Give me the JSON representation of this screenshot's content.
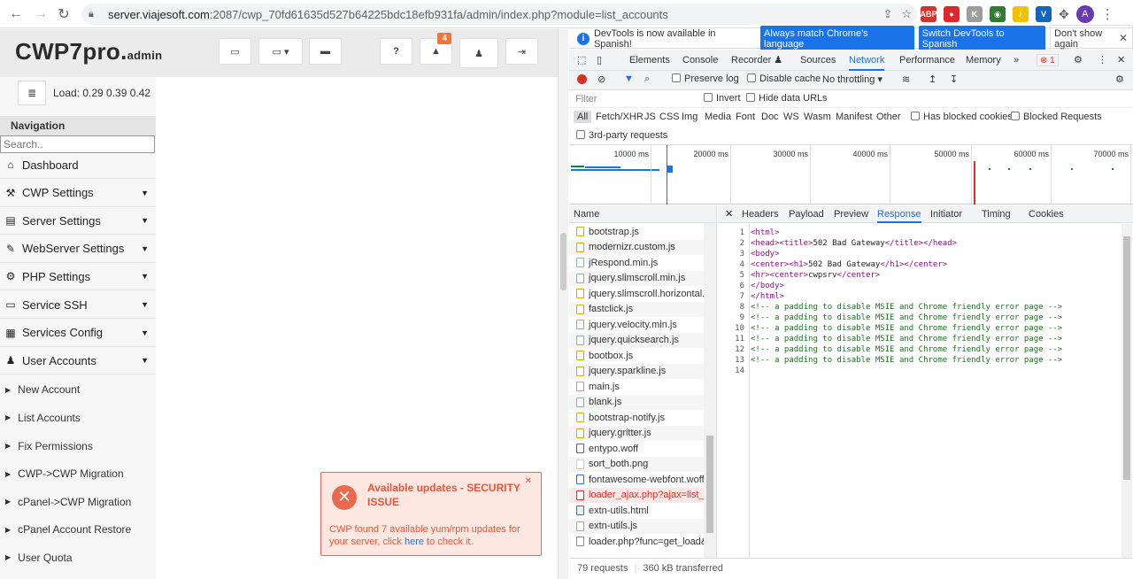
{
  "browser": {
    "url_host": "server.viajesoft.com",
    "url_rest": ":2087/cwp_70fd61635d527b64225bdc18efb931fa/admin/index.php?module=list_accounts",
    "avatar_letter": "A",
    "extensions": [
      {
        "name": "abp-icon",
        "label": "ABP",
        "color": "#d9302c"
      },
      {
        "name": "red-shield-icon",
        "label": "●",
        "color": "#e0262c"
      },
      {
        "name": "k-icon",
        "label": "K",
        "color": "#9e9e9e"
      },
      {
        "name": "globe-icon",
        "label": "◉",
        "color": "#2e7d32"
      },
      {
        "name": "note-icon",
        "label": "/",
        "color": "#f2c200"
      },
      {
        "name": "v-icon",
        "label": "V",
        "color": "#1565c0"
      }
    ]
  },
  "app": {
    "logo": "CWP7pro.",
    "logo_suffix": "admin",
    "notifications_count": "4",
    "load_label": "Load: 0.29  0.39  0.42",
    "nav_title": "Navigation",
    "search_placeholder": "Search..",
    "menu": [
      {
        "label": "Dashboard",
        "icon": "⌂",
        "caret": false
      },
      {
        "label": "CWP Settings",
        "icon": "⚒",
        "caret": true
      },
      {
        "label": "Server Settings",
        "icon": "▤",
        "caret": true
      },
      {
        "label": "WebServer Settings",
        "icon": "✎",
        "caret": true
      },
      {
        "label": "PHP Settings",
        "icon": "⚙",
        "caret": true
      },
      {
        "label": "Service SSH",
        "icon": "▭",
        "caret": true
      },
      {
        "label": "Services Config",
        "icon": "▦",
        "caret": true
      },
      {
        "label": "User Accounts",
        "icon": "♟",
        "caret": true
      }
    ],
    "submenu": [
      "New Account",
      "List Accounts",
      "Fix Permissions",
      "CWP->CWP Migration",
      "cPanel->CWP Migration",
      "cPanel Account Restore",
      "User Quota"
    ]
  },
  "notification": {
    "title": "Available updates - SECURITY ISSUE",
    "body_prefix": "CWP found 7 available yum/rpm updates for your server, click ",
    "link": "here",
    "body_suffix": " to check it."
  },
  "devtools": {
    "info_msg": "DevTools is now available in Spanish!",
    "btn_match": "Always match Chrome's language",
    "btn_switch": "Switch DevTools to Spanish",
    "btn_dont": "Don't show again",
    "tabs": [
      "Elements",
      "Console",
      "Recorder ♟",
      "Sources",
      "Network",
      "Performance",
      "Memory"
    ],
    "error_count": "1",
    "preserve_log": "Preserve log",
    "disable_cache": "Disable cache",
    "throttling": "No throttling",
    "filter_placeholder": "Filter",
    "invert": "Invert",
    "hide_data_urls": "Hide data URLs",
    "types": [
      "All",
      "Fetch/XHR",
      "JS",
      "CSS",
      "Img",
      "Media",
      "Font",
      "Doc",
      "WS",
      "Wasm",
      "Manifest",
      "Other"
    ],
    "has_blocked_cookies": "Has blocked cookies",
    "blocked_requests": "Blocked Requests",
    "third_party": "3rd-party requests",
    "timeline_ticks": [
      "10000 ms",
      "20000 ms",
      "30000 ms",
      "40000 ms",
      "50000 ms",
      "60000 ms",
      "70000 ms"
    ],
    "name_header": "Name",
    "requests": [
      {
        "name": "bootstrap.js",
        "type": "js"
      },
      {
        "name": "modernizr.custom.js",
        "type": "js"
      },
      {
        "name": "jRespond.min.js",
        "type": "js"
      },
      {
        "name": "jquery.slimscroll.min.js",
        "type": "js"
      },
      {
        "name": "jquery.slimscroll.horizontal.mi",
        "type": "js"
      },
      {
        "name": "fastclick.js",
        "type": "js"
      },
      {
        "name": "jquery.velocity.min.js",
        "type": "js"
      },
      {
        "name": "jquery.quicksearch.js",
        "type": "js"
      },
      {
        "name": "bootbox.js",
        "type": "js"
      },
      {
        "name": "jquery.sparkline.js",
        "type": "js"
      },
      {
        "name": "main.js",
        "type": "js"
      },
      {
        "name": "blank.js",
        "type": "js"
      },
      {
        "name": "bootstrap-notify.js",
        "type": "js"
      },
      {
        "name": "jquery.gritter.js",
        "type": "js"
      },
      {
        "name": "entypo.woff",
        "type": "font"
      },
      {
        "name": "sort_both.png",
        "type": "img"
      },
      {
        "name": "fontawesome-webfont.woff?v",
        "type": "font"
      },
      {
        "name": "loader_ajax.php?ajax=list_acc",
        "type": "err"
      },
      {
        "name": "extn-utils.html",
        "type": "doc"
      },
      {
        "name": "extn-utils.js",
        "type": "js"
      },
      {
        "name": "loader.php?func=get_load&_",
        "type": "gen"
      }
    ],
    "status_requests": "79 requests",
    "status_transferred": "360 kB transferred",
    "detail_tabs": [
      "Headers",
      "Payload",
      "Preview",
      "Response",
      "Initiator",
      "Timing",
      "Cookies"
    ],
    "code_lines": [
      {
        "n": "1",
        "segs": [
          [
            "tag",
            "<html>"
          ]
        ]
      },
      {
        "n": "2",
        "segs": [
          [
            "tag",
            "<head><title>"
          ],
          [
            "txt",
            "502 Bad Gateway"
          ],
          [
            "tag",
            "</title></head>"
          ]
        ]
      },
      {
        "n": "3",
        "segs": [
          [
            "tag",
            "<body>"
          ]
        ]
      },
      {
        "n": "4",
        "segs": [
          [
            "tag",
            "<center><h1>"
          ],
          [
            "txt",
            "502 Bad Gateway"
          ],
          [
            "tag",
            "</h1></center>"
          ]
        ]
      },
      {
        "n": "5",
        "segs": [
          [
            "tag",
            "<hr><center>"
          ],
          [
            "txt",
            "cwpsrv"
          ],
          [
            "tag",
            "</center>"
          ]
        ]
      },
      {
        "n": "6",
        "segs": [
          [
            "tag",
            "</body>"
          ]
        ]
      },
      {
        "n": "7",
        "segs": [
          [
            "tag",
            "</html>"
          ]
        ]
      },
      {
        "n": "8",
        "segs": [
          [
            "cmt",
            "<!-- a padding to disable MSIE and Chrome friendly error page -->"
          ]
        ]
      },
      {
        "n": "9",
        "segs": [
          [
            "cmt",
            "<!-- a padding to disable MSIE and Chrome friendly error page -->"
          ]
        ]
      },
      {
        "n": "10",
        "segs": [
          [
            "cmt",
            "<!-- a padding to disable MSIE and Chrome friendly error page -->"
          ]
        ]
      },
      {
        "n": "11",
        "segs": [
          [
            "cmt",
            "<!-- a padding to disable MSIE and Chrome friendly error page -->"
          ]
        ]
      },
      {
        "n": "12",
        "segs": [
          [
            "cmt",
            "<!-- a padding to disable MSIE and Chrome friendly error page -->"
          ]
        ]
      },
      {
        "n": "13",
        "segs": [
          [
            "cmt",
            "<!-- a padding to disable MSIE and Chrome friendly error page -->"
          ]
        ]
      },
      {
        "n": "14",
        "segs": []
      }
    ]
  }
}
